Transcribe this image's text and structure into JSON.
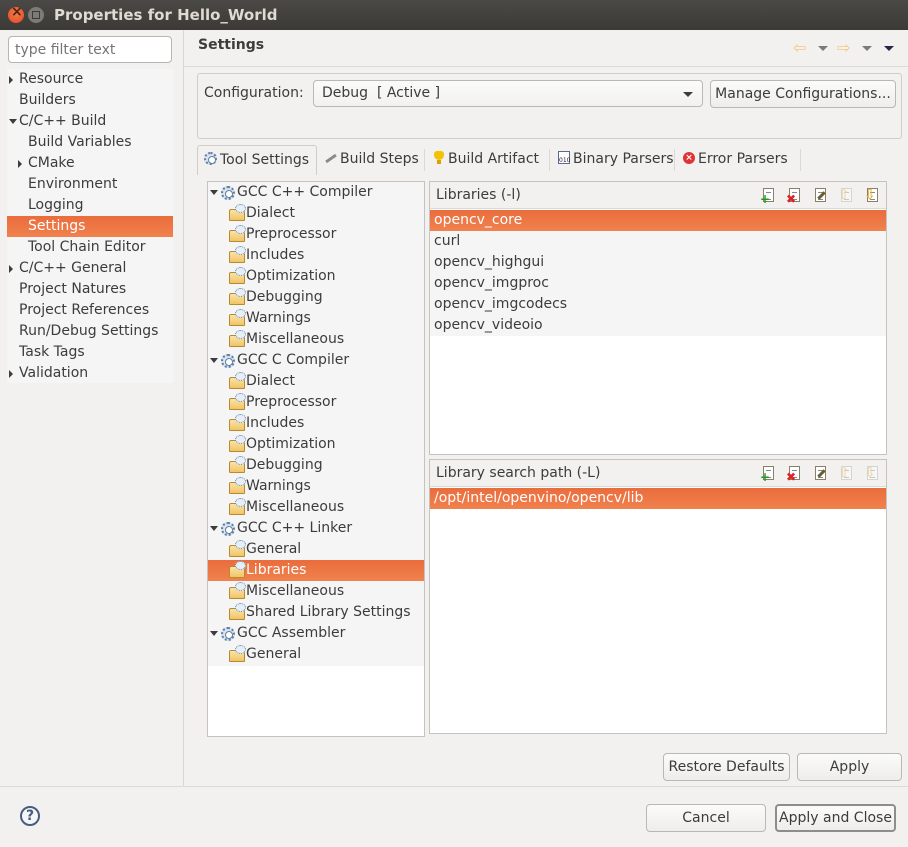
{
  "window": {
    "title": "Properties for Hello_World"
  },
  "filter": {
    "placeholder": "type filter text",
    "value": ""
  },
  "sidebar": {
    "items": [
      {
        "label": "Resource",
        "expander": "collapsed",
        "indent": 0
      },
      {
        "label": "Builders",
        "expander": "none",
        "indent": 0
      },
      {
        "label": "C/C++ Build",
        "expander": "expanded",
        "indent": 0
      },
      {
        "label": "Build Variables",
        "expander": "none",
        "indent": 1
      },
      {
        "label": "CMake",
        "expander": "collapsed",
        "indent": 1
      },
      {
        "label": "Environment",
        "expander": "none",
        "indent": 1
      },
      {
        "label": "Logging",
        "expander": "none",
        "indent": 1
      },
      {
        "label": "Settings",
        "expander": "none",
        "indent": 1,
        "selected": true
      },
      {
        "label": "Tool Chain Editor",
        "expander": "none",
        "indent": 1
      },
      {
        "label": "C/C++ General",
        "expander": "collapsed",
        "indent": 0
      },
      {
        "label": "Project Natures",
        "expander": "none",
        "indent": 0
      },
      {
        "label": "Project References",
        "expander": "none",
        "indent": 0
      },
      {
        "label": "Run/Debug Settings",
        "expander": "none",
        "indent": 0
      },
      {
        "label": "Task Tags",
        "expander": "none",
        "indent": 0
      },
      {
        "label": "Validation",
        "expander": "collapsed",
        "indent": 0
      }
    ]
  },
  "page": {
    "title": "Settings",
    "nav_icons": [
      "back-arrow-icon",
      "back-history-dropdown",
      "forward-arrow-icon",
      "forward-history-dropdown",
      "view-menu-dropdown"
    ]
  },
  "configuration": {
    "label": "Configuration:",
    "selected": "Debug  [ Active ]",
    "manage_button": "Manage Configurations..."
  },
  "tabs": [
    {
      "label": "Tool Settings",
      "icon": "tool-settings-icon",
      "active": true
    },
    {
      "label": "Build Steps",
      "icon": "build-steps-icon"
    },
    {
      "label": "Build Artifact",
      "icon": "build-artifact-icon"
    },
    {
      "label": "Binary Parsers",
      "icon": "binary-parsers-icon"
    },
    {
      "label": "Error Parsers",
      "icon": "error-parsers-icon"
    }
  ],
  "tool_tree": [
    {
      "label": "GCC C++ Compiler",
      "type": "tool"
    },
    {
      "label": "Dialect",
      "type": "option"
    },
    {
      "label": "Preprocessor",
      "type": "option"
    },
    {
      "label": "Includes",
      "type": "option"
    },
    {
      "label": "Optimization",
      "type": "option"
    },
    {
      "label": "Debugging",
      "type": "option"
    },
    {
      "label": "Warnings",
      "type": "option"
    },
    {
      "label": "Miscellaneous",
      "type": "option"
    },
    {
      "label": "GCC C Compiler",
      "type": "tool"
    },
    {
      "label": "Dialect",
      "type": "option"
    },
    {
      "label": "Preprocessor",
      "type": "option"
    },
    {
      "label": "Includes",
      "type": "option"
    },
    {
      "label": "Optimization",
      "type": "option"
    },
    {
      "label": "Debugging",
      "type": "option"
    },
    {
      "label": "Warnings",
      "type": "option"
    },
    {
      "label": "Miscellaneous",
      "type": "option"
    },
    {
      "label": "GCC C++ Linker",
      "type": "tool"
    },
    {
      "label": "General",
      "type": "option"
    },
    {
      "label": "Libraries",
      "type": "option",
      "selected": true
    },
    {
      "label": "Miscellaneous",
      "type": "option"
    },
    {
      "label": "Shared Library Settings",
      "type": "option"
    },
    {
      "label": "GCC Assembler",
      "type": "tool"
    },
    {
      "label": "General",
      "type": "option"
    }
  ],
  "libraries": {
    "title": "Libraries (-l)",
    "toolbar": [
      "add-icon",
      "delete-icon",
      "edit-icon",
      "move-up-icon",
      "move-down-icon"
    ],
    "items": [
      "opencv_core",
      "curl",
      "opencv_highgui",
      "opencv_imgproc",
      "opencv_imgcodecs",
      "opencv_videoio"
    ],
    "selected_index": 0
  },
  "library_paths": {
    "title": "Library search path (-L)",
    "toolbar": [
      "add-icon",
      "delete-icon",
      "edit-icon",
      "move-up-icon",
      "move-down-icon"
    ],
    "items": [
      "/opt/intel/openvino/opencv/lib"
    ],
    "selected_index": 0
  },
  "buttons": {
    "restore_defaults": "Restore Defaults",
    "apply": "Apply",
    "cancel": "Cancel",
    "apply_and_close": "Apply and Close"
  },
  "colors": {
    "selection": "#ee7540",
    "background": "#f2f1f0",
    "titlebar": "#3f3e3a"
  }
}
